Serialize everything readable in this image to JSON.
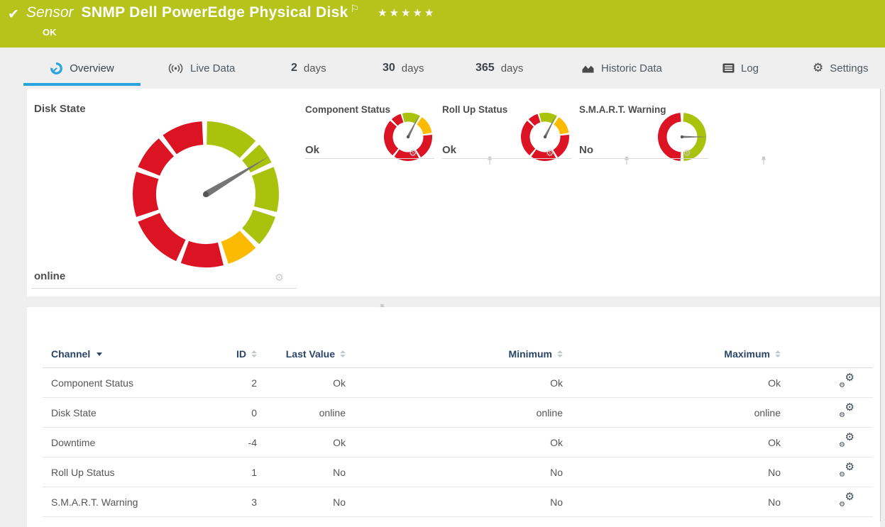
{
  "icons": {
    "check": "✔",
    "flag": "⚐",
    "gear": "⚙"
  },
  "header": {
    "type_label": "Sensor",
    "title": "SNMP Dell PowerEdge Physical Disk",
    "status": "OK",
    "rating": "★★★★★",
    "bar_color": "#b5c31b"
  },
  "tabs": {
    "overview": {
      "label": "Overview",
      "active": true
    },
    "live_data": {
      "label": "Live Data"
    },
    "days2": {
      "num": "2",
      "unit": "days"
    },
    "days30": {
      "num": "30",
      "unit": "days"
    },
    "days365": {
      "num": "365",
      "unit": "days"
    },
    "historic": {
      "label": "Historic Data"
    },
    "log": {
      "label": "Log"
    },
    "settings": {
      "label": "Settings"
    },
    "active_underline_color": "#2aa4dd"
  },
  "gauges": {
    "palette": {
      "red": "#dc1323",
      "green": "#a9c30d",
      "yellow": "#fcba00",
      "needle": "#757575",
      "pivot": "#555555"
    },
    "tiles": [
      {
        "title": "Disk State",
        "value": "online"
      },
      {
        "title": "Component Status",
        "value": "Ok"
      },
      {
        "title": "Roll Up Status",
        "value": "Ok"
      },
      {
        "title": "S.M.A.R.T. Warning",
        "value": "No"
      }
    ],
    "defs": {
      "disk_state": {
        "size": 212,
        "outer_r": 103,
        "inner_r": 70,
        "needle_deg": 59,
        "needle_len": 104,
        "needle_base": 4.5,
        "pivot_r": 4,
        "segments": [
          {
            "from": 1,
            "to": 43,
            "color": "green"
          },
          {
            "from": 47,
            "to": 64,
            "color": "green"
          },
          {
            "from": 68,
            "to": 104,
            "color": "green"
          },
          {
            "from": 108,
            "to": 133,
            "color": "green"
          },
          {
            "from": 137,
            "to": 162,
            "color": "yellow"
          },
          {
            "from": 166,
            "to": 200,
            "color": "red"
          },
          {
            "from": 204,
            "to": 248,
            "color": "red"
          },
          {
            "from": 252,
            "to": 288,
            "color": "red"
          },
          {
            "from": 292,
            "to": 320,
            "color": "red"
          },
          {
            "from": 324,
            "to": 357,
            "color": "red"
          }
        ]
      },
      "status_small": {
        "size": 72,
        "outer_r": 34,
        "inner_r": 21.5,
        "needle_deg": 27,
        "needle_len": 34,
        "needle_base": 1.8,
        "pivot_r": 2.2,
        "segments": [
          {
            "from": -14,
            "to": 30,
            "color": "green"
          },
          {
            "from": 35,
            "to": 80,
            "color": "yellow"
          },
          {
            "from": 85,
            "to": 148,
            "color": "red"
          },
          {
            "from": 153,
            "to": 215,
            "color": "red"
          },
          {
            "from": 220,
            "to": 312,
            "color": "red"
          },
          {
            "from": 317,
            "to": 342,
            "color": "red"
          }
        ]
      },
      "smart": {
        "size": 72,
        "outer_r": 34,
        "inner_r": 21.5,
        "needle_deg": 90,
        "needle_len": 37,
        "needle_base": 1.5,
        "pivot_r": 2.2,
        "segments": [
          {
            "from": 4,
            "to": 176,
            "color": "green"
          },
          {
            "from": 184,
            "to": 356,
            "color": "red"
          }
        ]
      }
    }
  },
  "table": {
    "columns": [
      "Channel",
      "ID",
      "Last Value",
      "Minimum",
      "Maximum"
    ],
    "rows": [
      {
        "channel": "Component Status",
        "id": "2",
        "last_value": "Ok",
        "minimum": "Ok",
        "maximum": "Ok"
      },
      {
        "channel": "Disk State",
        "id": "0",
        "last_value": "online",
        "minimum": "online",
        "maximum": "online"
      },
      {
        "channel": "Downtime",
        "id": "-4",
        "last_value": "Ok",
        "minimum": "Ok",
        "maximum": "Ok"
      },
      {
        "channel": "Roll Up Status",
        "id": "1",
        "last_value": "No",
        "minimum": "No",
        "maximum": "No"
      },
      {
        "channel": "S.M.A.R.T. Warning",
        "id": "3",
        "last_value": "No",
        "minimum": "No",
        "maximum": "No"
      }
    ]
  }
}
